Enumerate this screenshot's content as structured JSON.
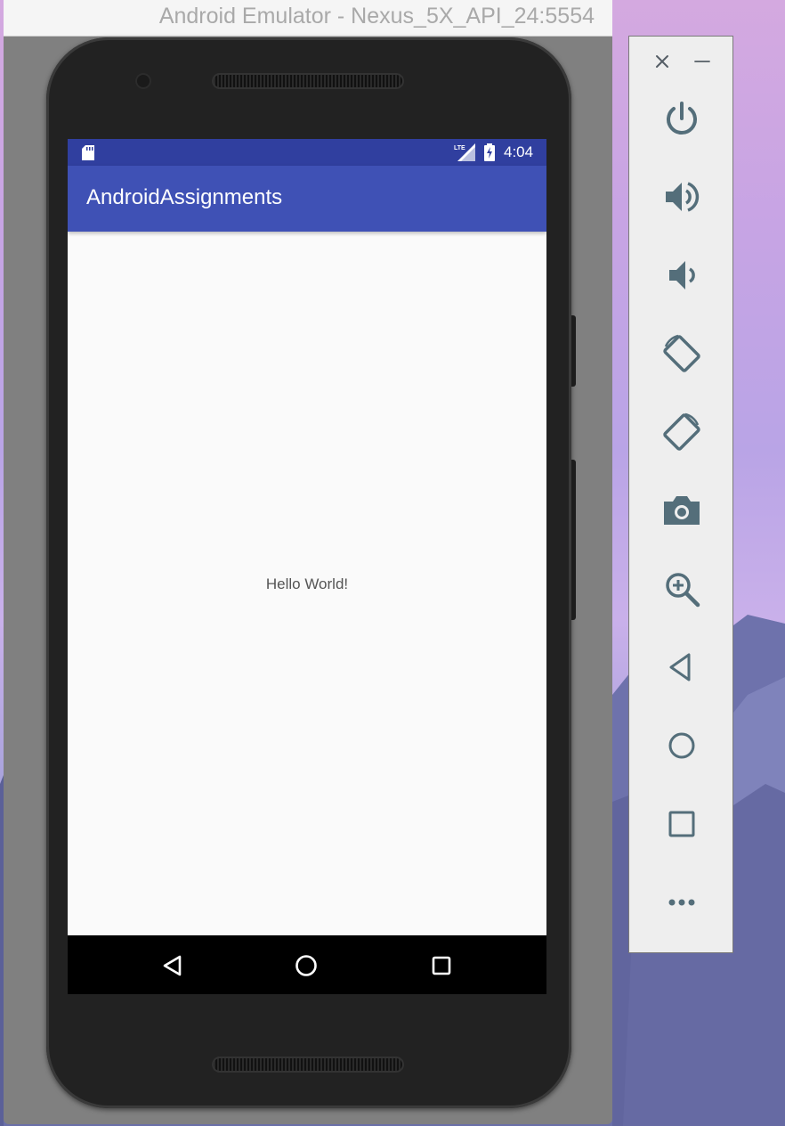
{
  "window": {
    "title": "Android Emulator - Nexus_5X_API_24:5554"
  },
  "device": {
    "status_bar": {
      "time": "4:04",
      "network_label": "LTE"
    },
    "app_bar": {
      "title": "AndroidAssignments"
    },
    "content": {
      "text": "Hello World!"
    },
    "colors": {
      "status_bar": "#303f9f",
      "app_bar": "#3f51b5",
      "background": "#fafafa"
    }
  },
  "toolbar": {
    "buttons": [
      {
        "icon": "close-icon"
      },
      {
        "icon": "minimize-icon"
      },
      {
        "icon": "power-icon"
      },
      {
        "icon": "volume-up-icon"
      },
      {
        "icon": "volume-down-icon"
      },
      {
        "icon": "rotate-left-icon"
      },
      {
        "icon": "rotate-right-icon"
      },
      {
        "icon": "camera-icon"
      },
      {
        "icon": "zoom-icon"
      },
      {
        "icon": "back-icon"
      },
      {
        "icon": "home-icon"
      },
      {
        "icon": "overview-icon"
      },
      {
        "icon": "more-icon"
      }
    ],
    "icon_color": "#546e7a"
  }
}
